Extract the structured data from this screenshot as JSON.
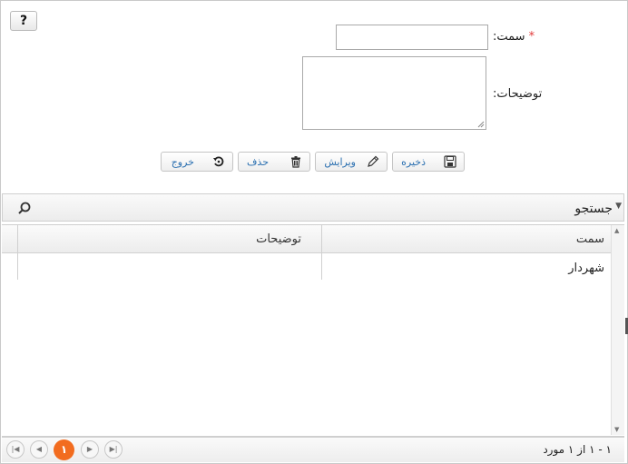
{
  "toolbar": {
    "help_label": "?"
  },
  "form": {
    "position_label": "سمت:",
    "required_mark": "*",
    "position_value": "",
    "description_label": "توضیحات:",
    "description_value": ""
  },
  "actions": {
    "save_label": "ذخیره",
    "edit_label": "ویرایش",
    "delete_label": "حذف",
    "exit_label": "خروج"
  },
  "search": {
    "label": "جستجو"
  },
  "grid": {
    "columns": [
      "سمت",
      "توضیحات"
    ],
    "rows": [
      {
        "position": "شهردار",
        "description": ""
      }
    ]
  },
  "pager": {
    "current_page": "۱",
    "info": "۱ - ۱ از ۱ مورد"
  }
}
